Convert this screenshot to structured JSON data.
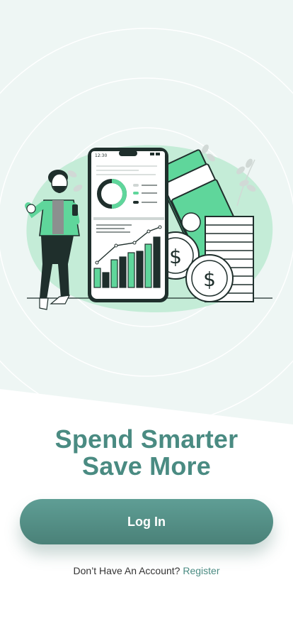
{
  "hero": {
    "illustration": "finance-growth-illustration",
    "phone_time": "12:30"
  },
  "headline": {
    "line1": "Spend Smarter",
    "line2": "Save More"
  },
  "actions": {
    "login_label": "Log In"
  },
  "footer": {
    "prompt": "Don’t Have An Account?",
    "register_link": "Register"
  },
  "colors": {
    "brand": "#4a8b82",
    "accent_green": "#5fd69b",
    "dark": "#1f2f2c",
    "hero_bg": "#eef6f4"
  }
}
